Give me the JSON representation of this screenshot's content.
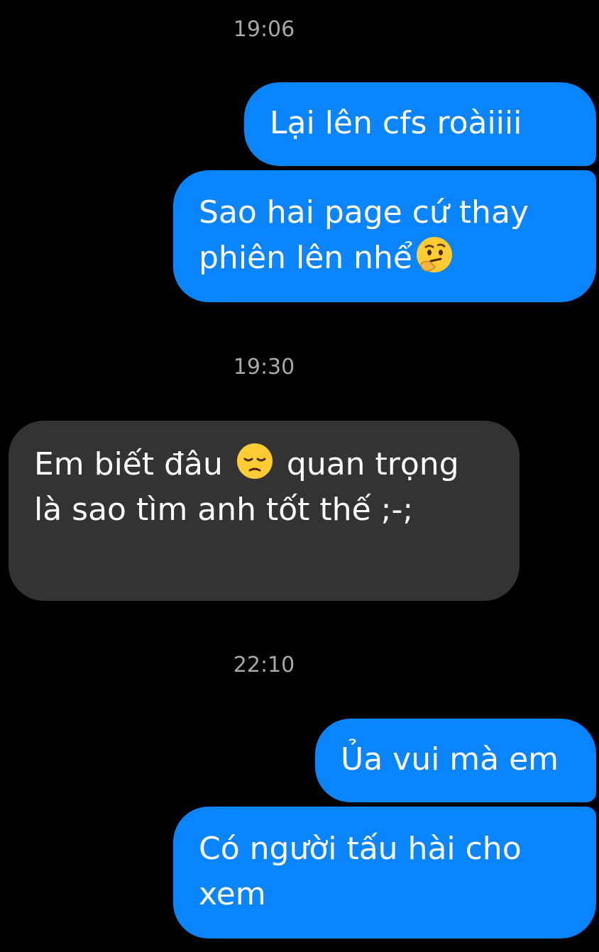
{
  "conversation": {
    "groups": [
      {
        "time": "19:06",
        "messages": [
          {
            "direction": "sent",
            "text": "Lại lên cfs roàiiii"
          },
          {
            "direction": "sent",
            "text_before": "Sao hai page cứ thay phiên lên nhể",
            "emoji": "thinking-face-icon"
          }
        ]
      },
      {
        "time": "19:30",
        "messages": [
          {
            "direction": "received",
            "text_before": "Em biết đâu",
            "emoji": "pensive-face-icon",
            "text_after": "quan trọng là sao tìm anh tốt thế ;-;"
          }
        ]
      },
      {
        "time": "22:10",
        "messages": [
          {
            "direction": "sent",
            "text": "Ủa vui mà em"
          },
          {
            "direction": "sent",
            "text": "Có người tấu hài cho xem"
          }
        ]
      }
    ]
  },
  "colors": {
    "background": "#000000",
    "sent_bubble": "#0a84ff",
    "received_bubble": "#333333",
    "timestamp": "#a8a8a8",
    "text": "#ffffff"
  }
}
